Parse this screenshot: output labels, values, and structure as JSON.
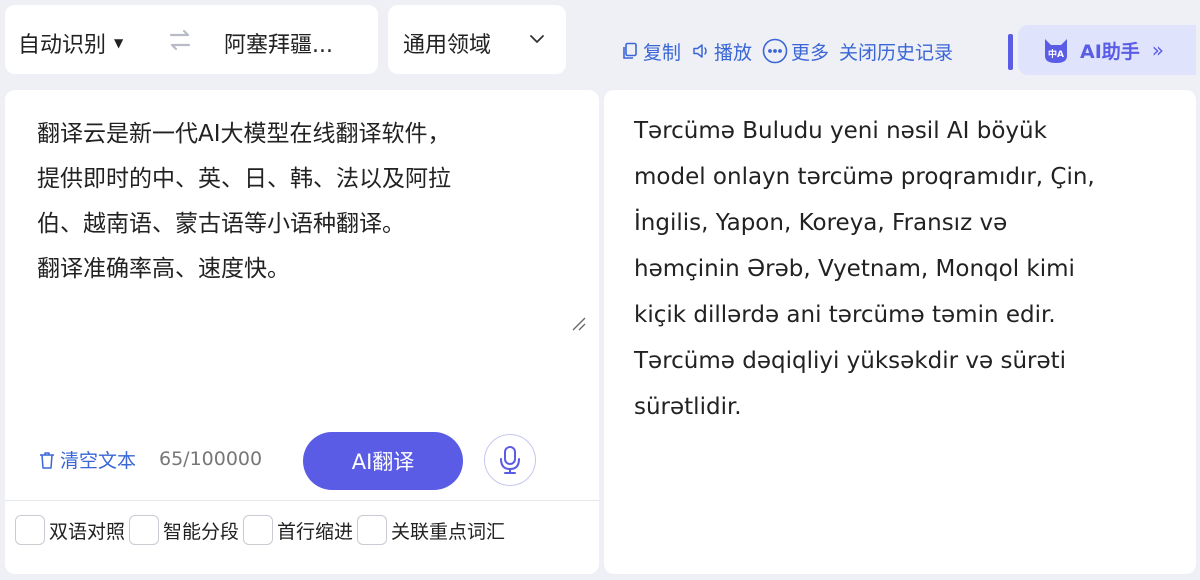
{
  "language_bar": {
    "source_language": "自动识别",
    "target_language": "阿塞拜疆..."
  },
  "domain_select": {
    "label": "通用领域"
  },
  "toolbar": {
    "copy_label": "复制",
    "play_label": "播放",
    "more_label": "更多",
    "history_label": "关闭历史记录",
    "ai_assistant_label": "AI助手",
    "ai_icon_text": "中A"
  },
  "source": {
    "text": "翻译云是新一代AI大模型在线翻译软件，\n提供即时的中、英、日、韩、法以及阿拉\n伯、越南语、蒙古语等小语种翻译。\n翻译准确率高、速度快。",
    "clear_label": "清空文本",
    "char_count": "65/100000",
    "translate_button": "AI翻译"
  },
  "options": [
    {
      "label": "双语对照",
      "checked": false
    },
    {
      "label": "智能分段",
      "checked": false
    },
    {
      "label": "首行缩进",
      "checked": false
    },
    {
      "label": "关联重点词汇",
      "checked": false
    }
  ],
  "target": {
    "text": "Tərcümə Buludu yeni nəsil AI böyük\nmodel onlayn tərcümə proqramıdır, Çin,\nİngilis, Yapon, Koreya, Fransız və\nhəmçinin Ərəb, Vyetnam, Monqol kimi\nkiçik dillərdə ani tərcümə təmin edir.\nTərcümə dəqiqliyi yüksəkdir və sürəti\nsürətlidir."
  },
  "colors": {
    "accent": "#5a5ce6",
    "link": "#3a66d6",
    "background": "#eef0f6"
  },
  "icons": [
    "swap-icon",
    "chevron-down-icon",
    "copy-icon",
    "speaker-icon",
    "more-icon",
    "ai-cat-icon",
    "double-chevron-right-icon",
    "trash-icon",
    "microphone-icon",
    "resize-handle-icon"
  ]
}
